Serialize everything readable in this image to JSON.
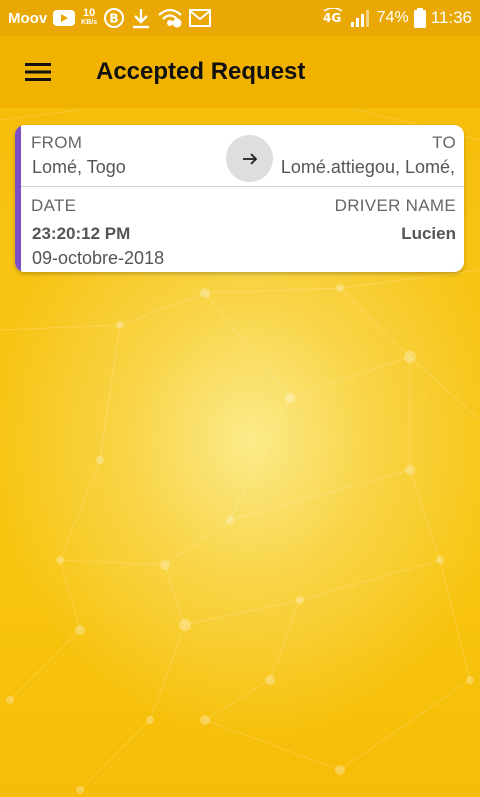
{
  "status_bar": {
    "carrier": "Moov",
    "speed_value": "10",
    "speed_unit": "KB/s",
    "network_type": "4G",
    "battery_percent": "74%",
    "time": "11:36",
    "icons": [
      "youtube-icon",
      "b-circle-icon",
      "download-icon",
      "wifi-hotspot-icon",
      "gmail-icon",
      "4g-lte-icon",
      "signal-icon",
      "battery-icon"
    ]
  },
  "app_bar": {
    "title": "Accepted Request",
    "menu_icon": "hamburger-menu-icon"
  },
  "request_card": {
    "from_label": "FROM",
    "from_value": "Lomé, Togo",
    "to_label": "TO",
    "to_value": "Lomé.attiegou, Lomé,",
    "arrow_icon": "arrow-right-icon",
    "date_label": "DATE",
    "driver_label": "DRIVER NAME",
    "time_value": "23:20:12 PM",
    "date_value": "09-octobre-2018",
    "driver_value": "Lucien"
  },
  "colors": {
    "accent_bar": "#7a4fc7",
    "app_bar": "#f2b300",
    "status_bar": "#e9a805",
    "background": "#f8c40f"
  }
}
